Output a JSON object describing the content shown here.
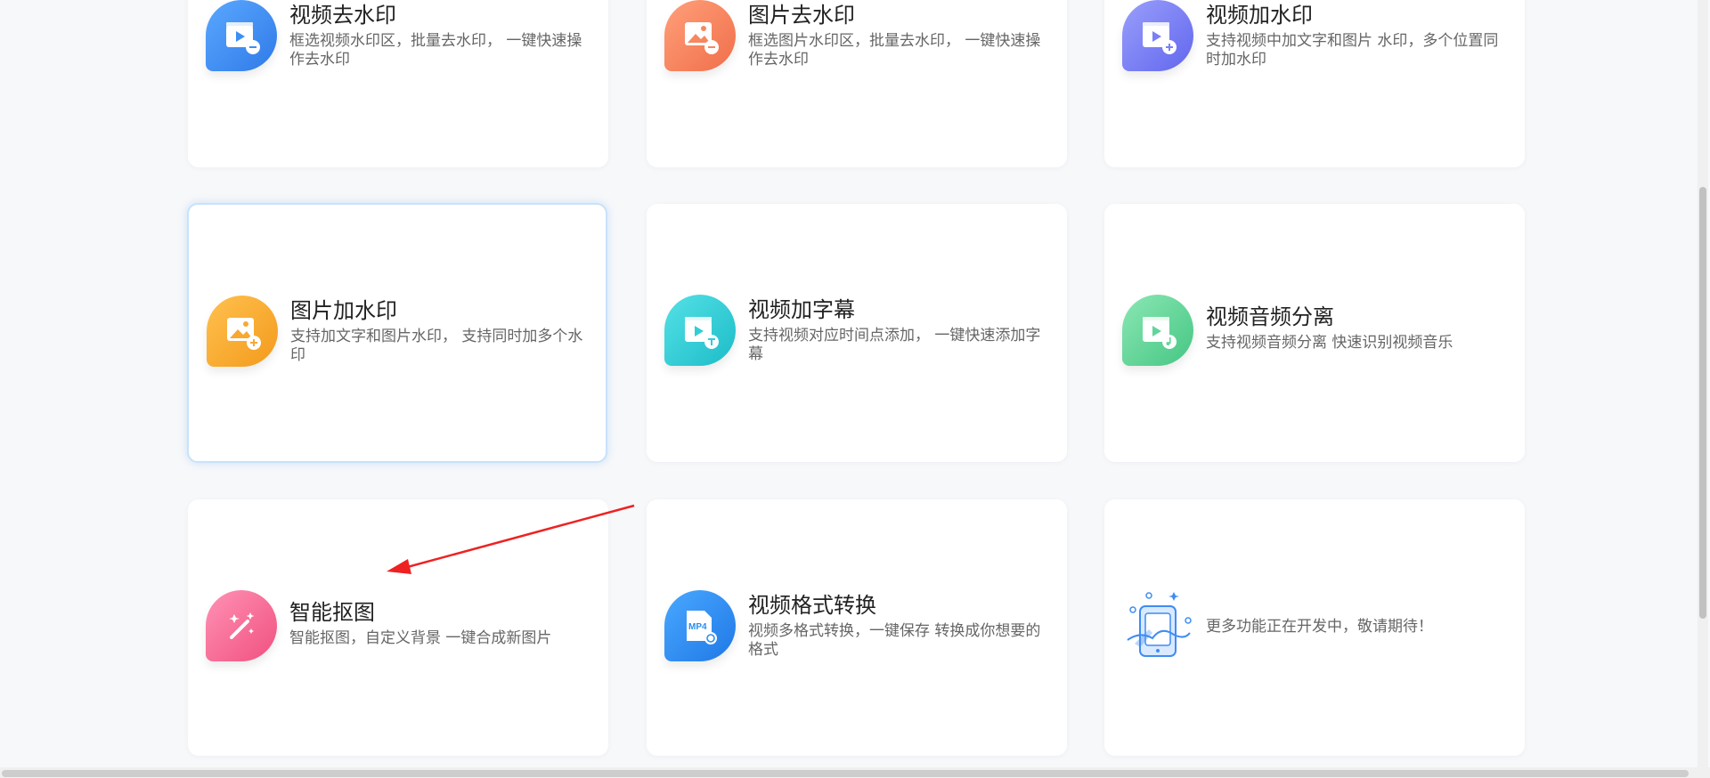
{
  "features": [
    {
      "title": "视频去水印",
      "desc": "框选视频水印区，批量去水印， 一键快速操作去水印",
      "icon": "video-remove-watermark-icon",
      "color": "#3d8ef5"
    },
    {
      "title": "图片去水印",
      "desc": "框选图片水印区，批量去水印， 一键快速操作去水印",
      "icon": "image-remove-watermark-icon",
      "color": "#f7875f"
    },
    {
      "title": "视频加水印",
      "desc": "支持视频中加文字和图片 水印，多个位置同时加水印",
      "icon": "video-add-watermark-icon",
      "color": "#7b80f6"
    },
    {
      "title": "图片加水印",
      "desc": "支持加文字和图片水印， 支持同时加多个水印",
      "icon": "image-add-watermark-icon",
      "color": "#f7a932"
    },
    {
      "title": "视频加字幕",
      "desc": "支持视频对应时间点添加， 一键快速添加字幕",
      "icon": "video-subtitle-icon",
      "color": "#2ecfd6"
    },
    {
      "title": "视频音频分离",
      "desc": "支持视频音频分离 快速识别视频音乐",
      "icon": "audio-separate-icon",
      "color": "#62d59a"
    },
    {
      "title": "智能抠图",
      "desc": "智能抠图，自定义背景 一键合成新图片",
      "icon": "magic-wand-icon",
      "color": "#f66b96"
    },
    {
      "title": "视频格式转换",
      "desc": "视频多格式转换，一键保存 转换成你想要的格式",
      "icon": "mp4-convert-icon",
      "color": "#2a8df2",
      "badge": "MP4"
    },
    {
      "title": "",
      "desc": "更多功能正在开发中，敬请期待！",
      "icon": "coming-soon-icon",
      "color": "#3f8cf3"
    }
  ]
}
